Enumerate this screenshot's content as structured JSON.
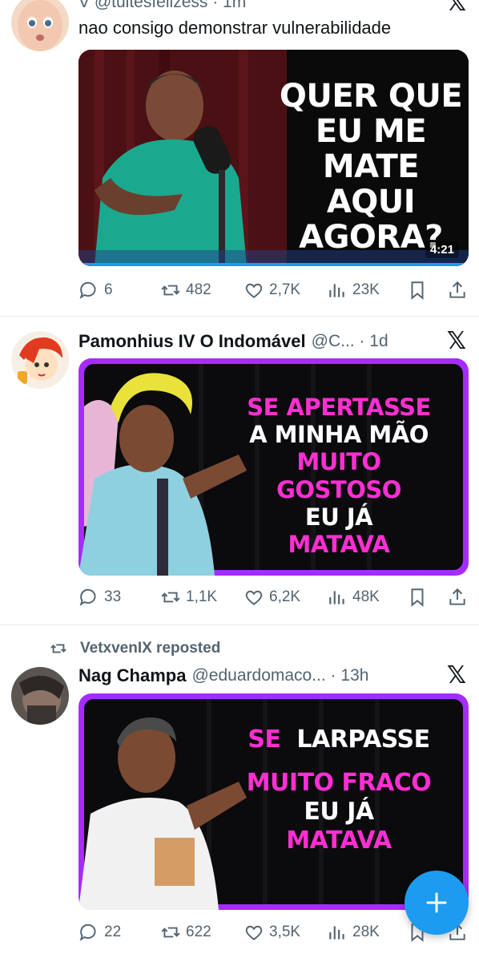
{
  "tweets": [
    {
      "name": "",
      "handle": "V @tuitesfelizess · 1m",
      "text": "nao consigo demonstrar vulnerabilidade",
      "image_caption": [
        "QUER QUE",
        "EU ME MATE",
        "AQUI",
        "AGORA?"
      ],
      "video_duration": "4:21",
      "stats": {
        "replies": "6",
        "reposts": "482",
        "likes": "2,7K",
        "views": "23K"
      }
    },
    {
      "name": "Pamonhius IV O Indomável",
      "handle": "@C... · 1d",
      "image_caption": [
        "SE APERTASSE",
        "A MINHA MÃO",
        "MUITO GOSTOSO",
        "EU JÁ",
        "MATAVA"
      ],
      "stats": {
        "replies": "33",
        "reposts": "1,1K",
        "likes": "6,2K",
        "views": "48K"
      }
    },
    {
      "repost_label": "VetxvenIX reposted",
      "name": "Nag Champa",
      "handle": "@eduardomaco... · 13h",
      "image_caption": [
        "SE",
        "LARPASSE",
        "MUITO FRACO",
        "EU JÁ",
        "MATAVA"
      ],
      "stats": {
        "replies": "22",
        "reposts": "622",
        "likes": "3,5K",
        "views": "28K"
      }
    }
  ],
  "colors": {
    "accent": "#1d9bf0",
    "muted": "#536471",
    "magenta": "#ff2fd1",
    "purple_frame": "#b326ff"
  },
  "icons": [
    "reply-icon",
    "repost-icon",
    "like-icon",
    "views-icon",
    "bookmark-icon",
    "share-icon",
    "x-logo-icon",
    "compose-plus-icon"
  ]
}
